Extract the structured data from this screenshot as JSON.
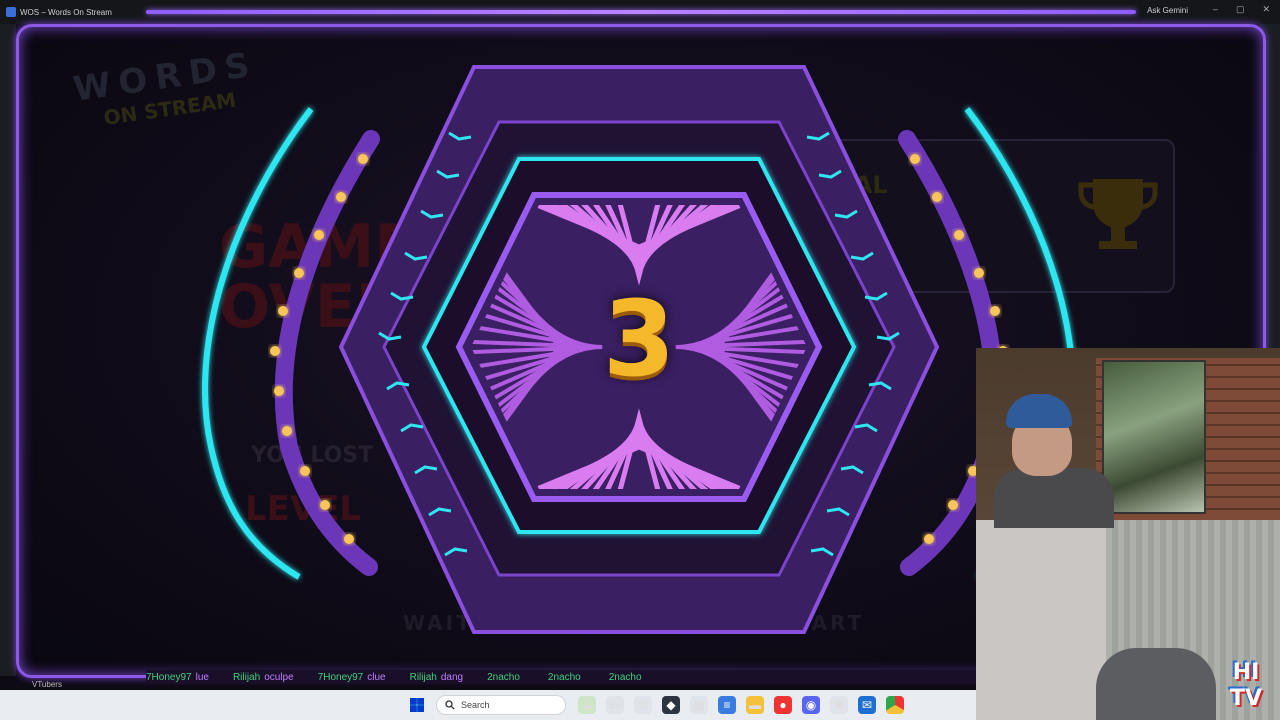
{
  "window": {
    "tab_title": "WOS – Words On Stream",
    "ask_label": "Ask Gemini",
    "controls": [
      "–",
      "▢",
      "✕"
    ]
  },
  "game": {
    "logo_line1": "WORDS",
    "logo_line2": "ON STREAM",
    "countdown": "3",
    "background_text": {
      "game_over": "GAME\nOVER",
      "you_lost": "YOU LOST",
      "level": "LEVEL",
      "waiting": "WAITIN",
      "start": "START",
      "global": "GLOBAL"
    },
    "colors": {
      "frame": "#8c5ae6",
      "neon_cyan": "#2fe6f0",
      "neon_purple": "#8b4fe0",
      "countdown": "#f4b82a"
    }
  },
  "ticker": {
    "items": [
      {
        "user": "7Honey97",
        "msg": "lue"
      },
      {
        "user": "Rilijah",
        "msg": "oculpe"
      },
      {
        "user": "7Honey97",
        "msg": "clue"
      },
      {
        "user": "Rilijah",
        "msg": "dang"
      },
      {
        "user": "2nacho",
        "msg": ""
      },
      {
        "user": "2nacho",
        "msg": ""
      },
      {
        "user": "2nacho",
        "msg": ""
      }
    ]
  },
  "side_label": "VTubers",
  "webcam": {
    "overlay_logo": "HI\nTV"
  },
  "taskbar": {
    "search_placeholder": "Search",
    "icons": [
      "widgets-icon",
      "task-view-icon",
      "settings-icon",
      "app-icon",
      "calculator-icon",
      "notes-icon",
      "folder-icon",
      "media-icon",
      "discord-icon",
      "chatgpt-icon",
      "outlook-icon",
      "chrome-icon"
    ]
  }
}
